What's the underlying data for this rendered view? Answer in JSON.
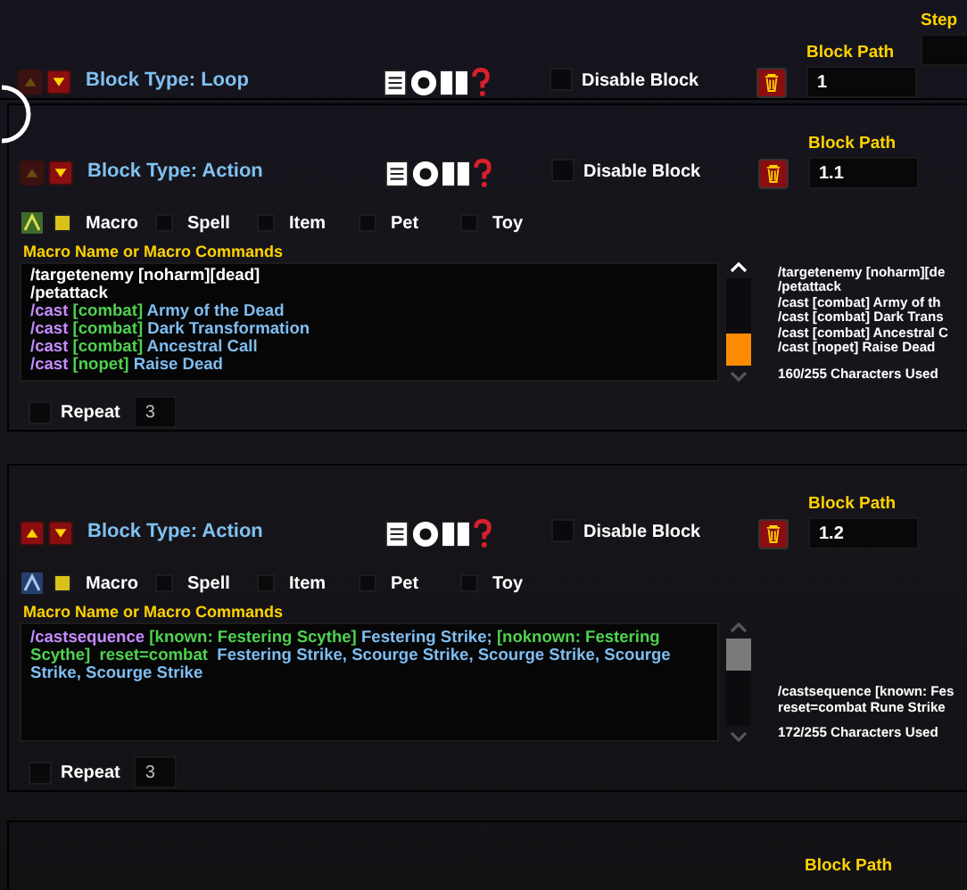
{
  "loop_block": {
    "title": "Block Type: Loop",
    "move_up_enabled": false,
    "disable_block": {
      "label": "Disable Block",
      "checked": false
    },
    "block_path": {
      "label": "Block Path",
      "value": "1"
    },
    "step": {
      "label": "Step"
    }
  },
  "action_blocks": [
    {
      "title": "Block Type: Action",
      "move_up_enabled": false,
      "disable_block": {
        "label": "Disable Block",
        "checked": false
      },
      "block_path": {
        "label": "Block Path",
        "value": "1.1"
      },
      "types": [
        {
          "label": "Macro",
          "selected": true
        },
        {
          "label": "Spell",
          "selected": false
        },
        {
          "label": "Item",
          "selected": false
        },
        {
          "label": "Pet",
          "selected": false
        },
        {
          "label": "Toy",
          "selected": false
        }
      ],
      "macro_label": "Macro Name or Macro Commands",
      "macro_lines": [
        [
          {
            "kind": "plain",
            "text": "/targetenemy [noharm][dead]"
          }
        ],
        [
          {
            "kind": "plain",
            "text": "/petattack"
          }
        ],
        [
          {
            "kind": "command",
            "text": "/cast "
          },
          {
            "kind": "condition",
            "text": "[combat] "
          },
          {
            "kind": "spell",
            "text": "Army of the Dead"
          }
        ],
        [
          {
            "kind": "command",
            "text": "/cast "
          },
          {
            "kind": "condition",
            "text": "[combat] "
          },
          {
            "kind": "spell",
            "text": "Dark Transformation"
          }
        ],
        [
          {
            "kind": "command",
            "text": "/cast "
          },
          {
            "kind": "condition",
            "text": "[combat] "
          },
          {
            "kind": "spell",
            "text": "Ancestral Call"
          }
        ],
        [
          {
            "kind": "command",
            "text": "/cast "
          },
          {
            "kind": "condition",
            "text": "[nopet] "
          },
          {
            "kind": "spell",
            "text": "Raise Dead"
          }
        ]
      ],
      "scrollbar": {
        "at_end": true,
        "hovered": true
      },
      "preview": [
        "/targetenemy [noharm][de",
        "/petattack",
        "/cast [combat] Army of th",
        "/cast [combat] Dark Trans",
        "/cast [combat] Ancestral C",
        "/cast [nopet] Raise Dead"
      ],
      "char_count": "160/255 Characters Used",
      "repeat": {
        "label": "Repeat",
        "checked": false,
        "value": "3"
      }
    },
    {
      "title": "Block Type: Action",
      "move_up_enabled": true,
      "disable_block": {
        "label": "Disable Block",
        "checked": false
      },
      "block_path": {
        "label": "Block Path",
        "value": "1.2"
      },
      "types": [
        {
          "label": "Macro",
          "selected": true
        },
        {
          "label": "Spell",
          "selected": false
        },
        {
          "label": "Item",
          "selected": false
        },
        {
          "label": "Pet",
          "selected": false
        },
        {
          "label": "Toy",
          "selected": false
        }
      ],
      "macro_label": "Macro Name or Macro Commands",
      "macro_lines": [
        [
          {
            "kind": "command",
            "text": "/castsequence "
          },
          {
            "kind": "condition",
            "text": "[known: Festering Scythe] "
          },
          {
            "kind": "spell",
            "text": "Festering Strike; "
          },
          {
            "kind": "condition",
            "text": "[noknown: Festering Scythe]  reset=combat  "
          },
          {
            "kind": "spell",
            "text": "Festering Strike, Scourge Strike, Scourge Strike, Scourge Strike, Scourge Strike"
          }
        ]
      ],
      "scrollbar": {
        "at_end": false,
        "hovered": false
      },
      "preview": [
        "/castsequence [known: Fes",
        "reset=combat  Rune Strike"
      ],
      "char_count": "172/255 Characters Used",
      "repeat": {
        "label": "Repeat",
        "checked": false,
        "value": "3"
      }
    }
  ],
  "next_block": {
    "block_path_label": "Block Path"
  }
}
